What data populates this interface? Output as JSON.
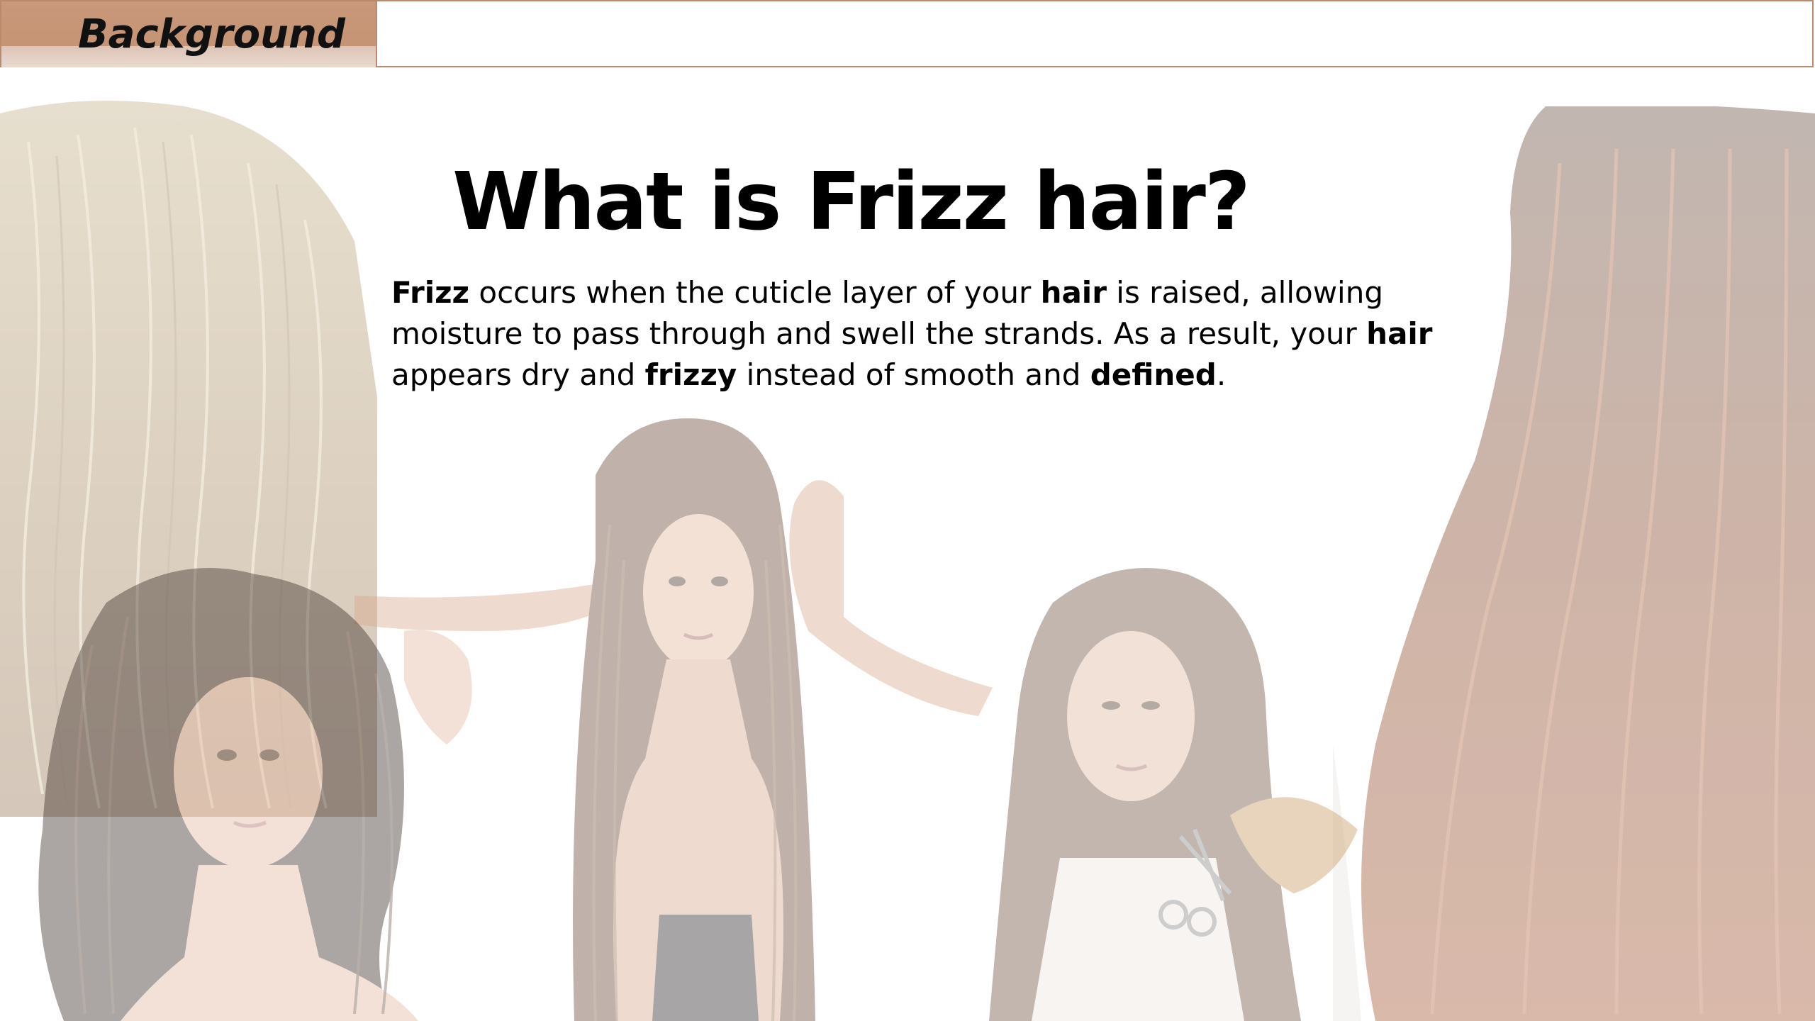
{
  "header": {
    "section_label": "Background"
  },
  "title": "What is Frizz hair?",
  "body": {
    "segments": [
      {
        "text": "Frizz",
        "bold": true
      },
      {
        "text": " occurs when the cuticle layer of your ",
        "bold": false
      },
      {
        "text": "hair",
        "bold": true
      },
      {
        "text": " is raised, allowing moisture to pass through and swell the strands. As a result, your ",
        "bold": false
      },
      {
        "text": "hair",
        "bold": true
      },
      {
        "text": " appears dry and ",
        "bold": false
      },
      {
        "text": "frizzy",
        "bold": true
      },
      {
        "text": " instead of smooth and ",
        "bold": false
      },
      {
        "text": "defined",
        "bold": true
      },
      {
        "text": ".",
        "bold": false
      }
    ]
  },
  "colors": {
    "accent": "#c49475",
    "accent_border": "#b98a6b",
    "text": "#000000"
  },
  "images": [
    {
      "name": "blonde-frizzy-hair-photo"
    },
    {
      "name": "auburn-wavy-hair-photo"
    },
    {
      "name": "woman-long-straight-hair-photo"
    },
    {
      "name": "woman-curly-dark-hair-photo"
    },
    {
      "name": "woman-cutting-split-ends-photo"
    }
  ]
}
